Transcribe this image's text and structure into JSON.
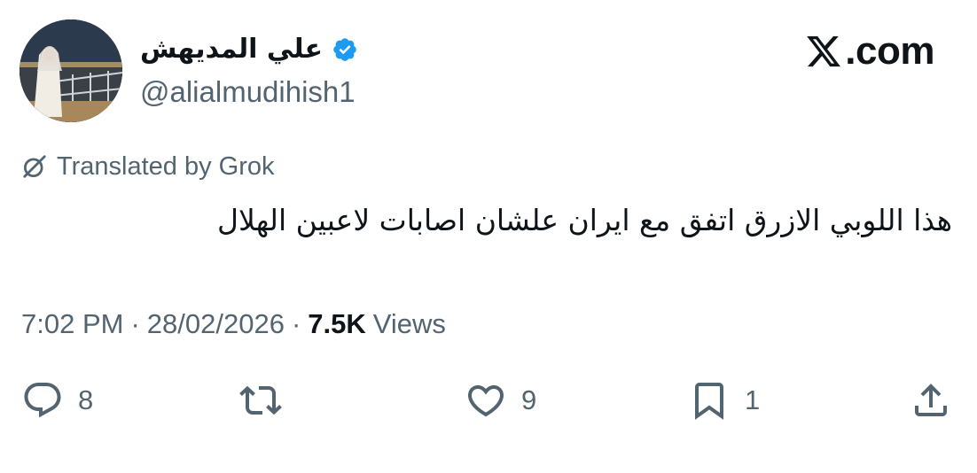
{
  "header": {
    "display_name": "علي المديهش",
    "handle": "@alialmudihish1",
    "brand": ".com",
    "brand_icon": "x-logo-icon",
    "verified_icon": "verified-badge-icon",
    "verified_color": "#1d9bf0"
  },
  "translation": {
    "icon": "grok-icon",
    "label": "Translated by Grok"
  },
  "tweet": {
    "text": "هذا اللوبي الازرق اتفق مع ايران علشان اصابات لاعبين الهلال"
  },
  "meta": {
    "time": "7:02 PM",
    "separator": "·",
    "date": "28/02/2026",
    "views_count": "7.5K",
    "views_label": "Views"
  },
  "actions": {
    "reply": {
      "icon": "reply-icon",
      "count": "8"
    },
    "retweet": {
      "icon": "retweet-icon",
      "count": ""
    },
    "like": {
      "icon": "heart-icon",
      "count": "9"
    },
    "bookmark": {
      "icon": "bookmark-icon",
      "count": "1"
    },
    "share": {
      "icon": "share-icon",
      "count": ""
    }
  },
  "colors": {
    "text_primary": "#0f1419",
    "text_secondary": "#536471",
    "verified": "#1d9bf0"
  }
}
